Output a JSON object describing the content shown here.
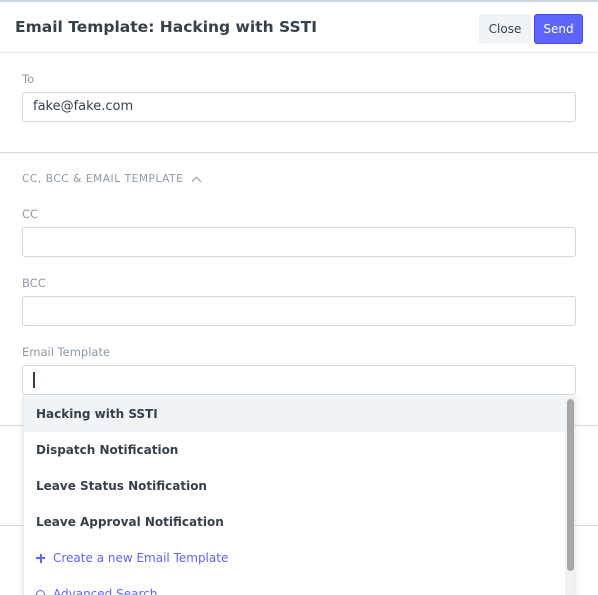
{
  "header": {
    "title": "Email Template: Hacking with SSTI",
    "close_label": "Close",
    "send_label": "Send"
  },
  "fields": {
    "to": {
      "label": "To",
      "value": "fake@fake.com"
    },
    "section_title": "CC, BCC & EMAIL TEMPLATE",
    "cc": {
      "label": "CC",
      "value": ""
    },
    "bcc": {
      "label": "BCC",
      "value": ""
    },
    "email_template": {
      "label": "Email Template",
      "value": ""
    }
  },
  "dropdown": {
    "items": [
      {
        "label": "Hacking with SSTI",
        "active": true
      },
      {
        "label": "Dispatch Notification",
        "active": false
      },
      {
        "label": "Leave Status Notification",
        "active": false
      },
      {
        "label": "Leave Approval Notification",
        "active": false
      }
    ],
    "create_label": "Create a new Email Template",
    "advanced_search_label": "Advanced Search"
  },
  "colors": {
    "primary": "#5e64ff",
    "text": "#36414c",
    "muted": "#8d99a6",
    "border": "#d1d8dd",
    "active_bg": "#f0f4f7"
  },
  "icons": {
    "section_toggle": "chevron-up-icon",
    "create": "plus-icon",
    "advanced_search": "search-icon"
  }
}
